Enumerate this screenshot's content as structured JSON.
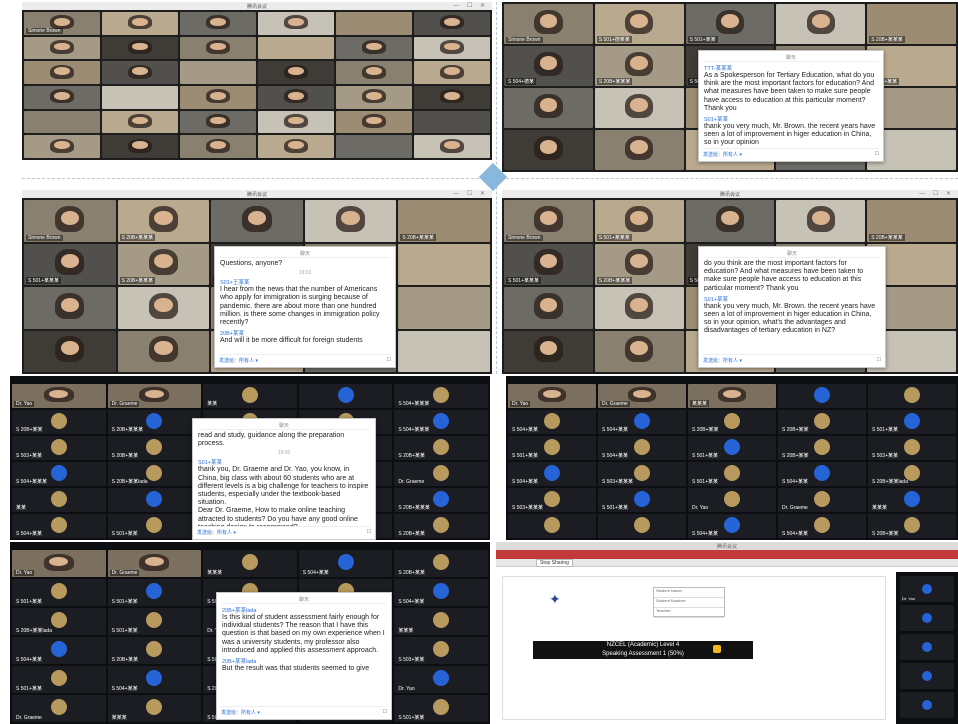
{
  "panels": {
    "p1": {
      "title": "腾讯会议",
      "window_controls": "— ☐ ✕",
      "participants": [
        "Simone Brown",
        "",
        "",
        "",
        "",
        "",
        "",
        "",
        "",
        "",
        "",
        "",
        "",
        "",
        "",
        "",
        "",
        "",
        "",
        "",
        "",
        "",
        "",
        "",
        "",
        "",
        "",
        "",
        "",
        "",
        "",
        "",
        "",
        "",
        "",
        ""
      ]
    },
    "p2": {
      "title": "腾讯会议",
      "window_controls": "— ☐ ✕",
      "participants": [
        "Simone Brown",
        "S 501+德某某",
        "S 501+某某",
        "",
        "S 20B+某某某",
        "S 504+德某",
        "S 20B+某某某",
        "S 501+王某某",
        "S 501+某某",
        "S 501+某某"
      ],
      "chat": {
        "header": "聊天",
        "messages": [
          {
            "sender": "TTT-某某某",
            "text": "As a Spokesperson for Tertiary Education, what do you think are the most important factors for education? And what measures have been taken to make sure people have access to education at this particular moment? Thank you"
          },
          {
            "sender": "S01+某某",
            "text": "thank you very much, Mr. Brown. the recent years have seen a lot of improvement in higer education in China, so in your opinion"
          }
        ],
        "footer_to": "发送给：所有人 ▾",
        "footer_icon": "☐"
      }
    },
    "p3": {
      "title": "腾讯会议",
      "window_controls": "— ☐ ✕",
      "participants": [
        "Simone Brown",
        "S 20B+某某某",
        "",
        "",
        "S 20B+某某某",
        "S 501+某某某",
        "S 20B+某某某",
        "S 501+某某某"
      ],
      "chat": {
        "header": "聊天",
        "messages": [
          {
            "sender": "",
            "text": "Questions, anyone?"
          },
          {
            "sender": "S01+王某某",
            "text": "I hear from the news that the number of Americans who apply for immigration is surging because of pandemic. there are about more than one hundred million. is there some changes in immigration policy recently?"
          },
          {
            "sender": "20B+某某",
            "text": "And will it be more difficult for foreign students"
          }
        ],
        "time": "19:03",
        "footer_to": "发送给：所有人 ▾",
        "footer_icon": "☐"
      }
    },
    "p4": {
      "title": "腾讯会议",
      "window_controls": "— ☐ ✕",
      "participants": [
        "Simone Brown",
        "S 501+某某某",
        "",
        "",
        "S 20B+某某某",
        "S 501+某某某",
        "S 20B+某某某",
        "S 501+王某某"
      ],
      "chat": {
        "header": "聊天",
        "messages": [
          {
            "sender": "",
            "text": "do you think are the most important factors for education? And what measures have been taken to make sure people have access to education at this particular moment? Thank you"
          },
          {
            "sender": "S01+某某",
            "text": "thank you very much, Mr. Brown. the recent years have seen a lot of improvement in higer education in China, so in your opinion, what's the advantages and disadvantages  of tertiary education in NZ?"
          }
        ],
        "footer_to": "发送给：所有人 ▾",
        "footer_icon": "☐"
      }
    },
    "p5": {
      "participants": [
        "Dr. Yao",
        "Dr. Graeme",
        "某某",
        "",
        "S 504+某某某",
        "S 20B+某某",
        "S 20B+某某某",
        "S 504+某某",
        "S 501+某某",
        "S 504+某某某",
        "S 503+某某",
        "S 20B+某某",
        "S 504+某某某",
        "S 501+某某",
        "S 20B+某某",
        "S 504+某某某",
        "S 20B+某某lada",
        "S 501+某某"
      ],
      "chat": {
        "header": "聊天",
        "messages": [
          {
            "sender": "",
            "text": "read and study, guidance along the preparation process."
          },
          {
            "sender": "S01+某某",
            "text": "thank you, Dr. Graeme and Dr. Yao, you know, in China, big class with about 60 students who are at different levels is a big challenge for teachers to inspire students, especially under the textbook-based situation."
          },
          {
            "sender": "",
            "text": "Dear Dr. Graeme, How to make online teaching attracted to students? Do you have any good online teaching design to recommend?"
          }
        ],
        "time": "19:00",
        "footer_to": "发送给：所有人 ▾",
        "footer_icon": "☐"
      }
    },
    "p6": {
      "participants": [
        "Dr. Yao",
        "Dr. Graeme",
        "某某某",
        "",
        "",
        "S 504+某某",
        "S 504+某某",
        "S 20B+某某",
        "S 20B+某某",
        "S 501+某某",
        "S 501+某某",
        "S 504+某某",
        "S 501+某某",
        "S 20B+某某",
        "S 503+某某",
        "S 504+某某",
        "S 503+某某某",
        "S 501+某某",
        "S 504+某某",
        "S 20B+某某lada",
        "S 503+某某某",
        "S 501+某某"
      ]
    },
    "p7": {
      "participants": [
        "Dr. Yao",
        "Dr. Graeme",
        "某某某",
        "S 504+某某",
        "S 20B+某某",
        "S 501+某某",
        "S 501+某某",
        "S 503+某某",
        "S 501+某某",
        "S 504+某某",
        "S 20B+某某lada",
        "S 501+某某"
      ],
      "chat": {
        "header": "聊天",
        "messages": [
          {
            "sender": "20B+某某lada",
            "text": "Is this kind of student assessment fairly enough for individual students? The reason that I have this question is that based on my own experience when I was a university students, my professor also introduced and applied this assessment approach."
          },
          {
            "sender": "20B+某某lada",
            "text": "But the result was that students seemed to give"
          }
        ],
        "footer_to": "发送给：所有人 ▾",
        "footer_icon": "☐"
      }
    },
    "p8": {
      "title": "腾讯会议",
      "browser_buttons": [
        "Stop Sharing"
      ],
      "doc_band_line1": "NZCEL (Academic) Level 4",
      "doc_band_line2": "Speaking Assessment 1 (50%)",
      "doc_fields": [
        "Student Name:",
        "Student Number:",
        "Teacher:"
      ],
      "side_participants": [
        "Dr. Yao",
        "",
        "",
        "",
        ""
      ]
    }
  },
  "colors": {
    "accent_blue": "#2563d6",
    "chat_sender": "#2a6fd6",
    "divider": "#89b8dc"
  }
}
